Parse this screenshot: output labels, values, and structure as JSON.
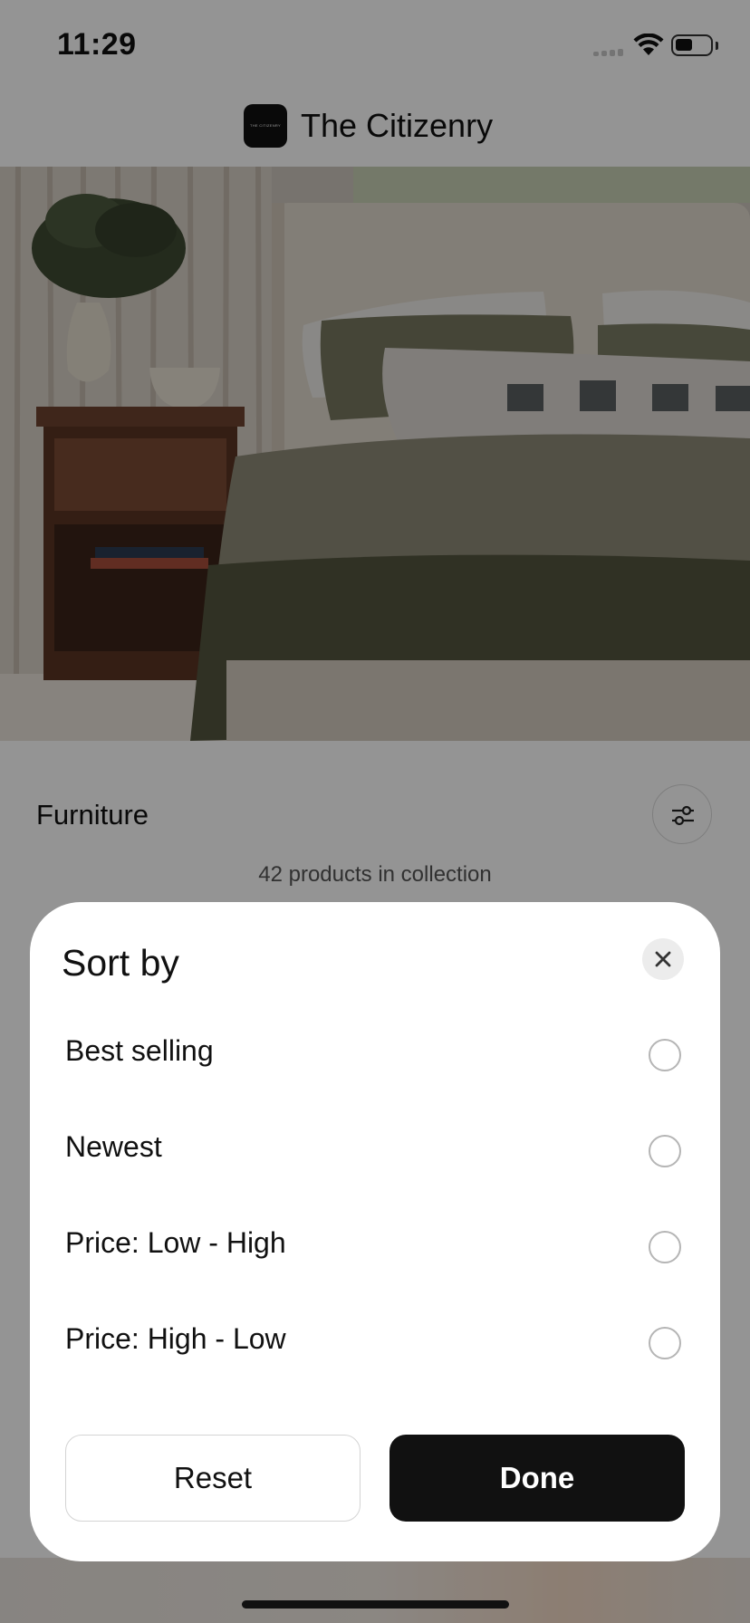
{
  "status_bar": {
    "time": "11:29"
  },
  "header": {
    "title": "The Citizenry",
    "logo_text": "THE CITIZENRY"
  },
  "collection": {
    "title": "Furniture",
    "count_text": "42 products in collection"
  },
  "sort_sheet": {
    "title": "Sort by",
    "options": [
      {
        "label": "Best selling",
        "selected": false
      },
      {
        "label": "Newest",
        "selected": false
      },
      {
        "label": "Price: Low - High",
        "selected": false
      },
      {
        "label": "Price: High - Low",
        "selected": false
      }
    ],
    "reset_label": "Reset",
    "done_label": "Done"
  },
  "icons": {
    "filter": "sliders-icon",
    "close": "close-icon",
    "wifi": "wifi-icon",
    "battery": "battery-icon"
  },
  "colors": {
    "primary_button": "#111111",
    "overlay": "rgba(0,0,0,0.42)"
  }
}
